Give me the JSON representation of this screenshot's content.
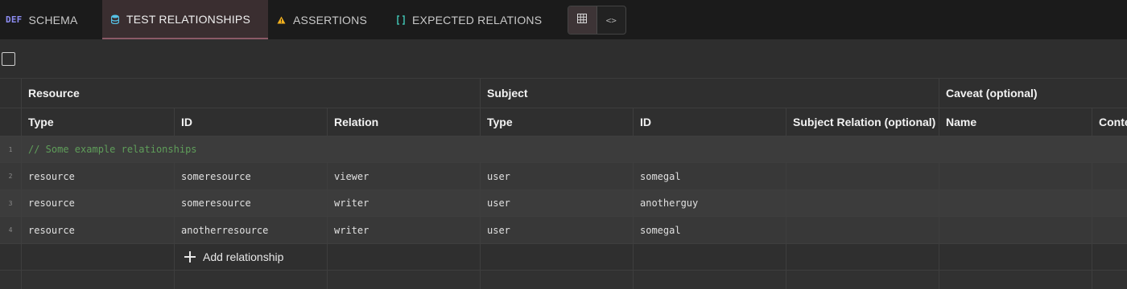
{
  "tabs": [
    {
      "label": "SCHEMA",
      "icon": "def-badge-icon",
      "icon_text": "DEF",
      "active": false
    },
    {
      "label": "TEST RELATIONSHIPS",
      "icon": "database-icon",
      "active": true
    },
    {
      "label": "ASSERTIONS",
      "icon": "warning-icon",
      "active": false
    },
    {
      "label": "EXPECTED RELATIONS",
      "icon": "brackets-icon",
      "active": false
    }
  ],
  "view_toggle": {
    "grid": "grid-view-icon",
    "code": "code-view-icon",
    "code_glyph": "<>"
  },
  "table": {
    "groups": {
      "resource": "Resource",
      "subject": "Subject",
      "caveat": "Caveat (optional)"
    },
    "columns": [
      "Type",
      "ID",
      "Relation",
      "Type",
      "ID",
      "Subject Relation (optional)",
      "Name",
      "Conte"
    ],
    "comment_row": {
      "num": "1",
      "text": "// Some example relationships"
    },
    "rows": [
      {
        "num": "2",
        "cells": [
          "resource",
          "someresource",
          "viewer",
          "user",
          "somegal",
          "",
          "",
          ""
        ]
      },
      {
        "num": "3",
        "cells": [
          "resource",
          "someresource",
          "writer",
          "user",
          "anotherguy",
          "",
          "",
          ""
        ]
      },
      {
        "num": "4",
        "cells": [
          "resource",
          "anotherresource",
          "writer",
          "user",
          "somegal",
          "",
          "",
          ""
        ]
      }
    ],
    "add_label": "Add relationship"
  },
  "colors": {
    "accent": "#8b5a66",
    "def": "#8c8cf2",
    "db": "#56c2e6",
    "warn": "#f2b01e",
    "brackets": "#3fbfb0",
    "comment": "#5f9e5a"
  }
}
